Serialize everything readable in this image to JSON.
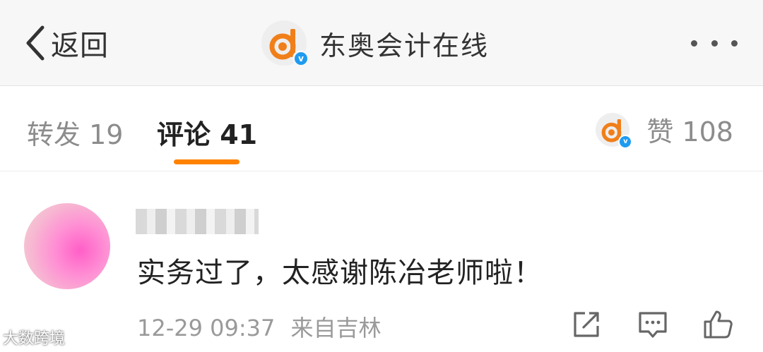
{
  "navbar": {
    "back_label": "返回",
    "title": "东奥会计在线",
    "verified_badge": "v",
    "icons": {
      "back": "chevron-left-icon",
      "more": "more-dots-icon"
    }
  },
  "tabs": {
    "repost": "转发 19",
    "comment": "评论 41",
    "likes": "赞 108",
    "active_color": "#ff8200"
  },
  "comment": {
    "text": "实务过了，太感谢陈冶老师啦！",
    "time": "12-29 09:37",
    "source": "来自吉林",
    "actions": [
      "share-icon",
      "reply-icon",
      "thumbs-up-icon"
    ]
  },
  "watermark": "大数跨境",
  "colors": {
    "accent": "#ff8200",
    "verified": "#1e9bf0",
    "brand": "#f07f1a"
  }
}
